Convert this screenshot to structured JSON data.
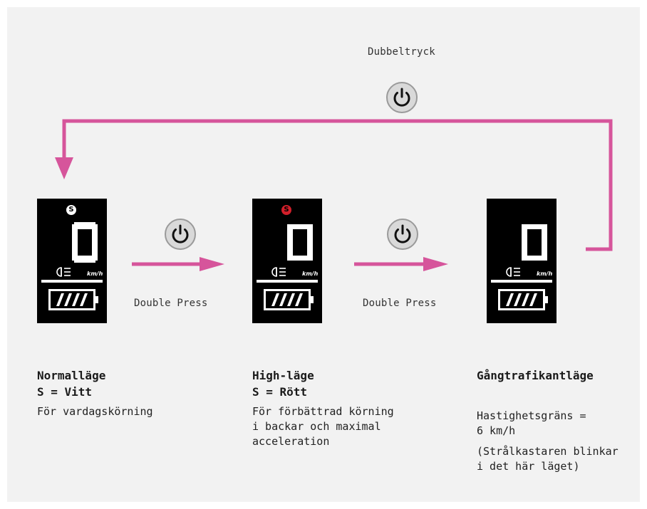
{
  "top_label": "Dubbeltryck",
  "arrow_labels": [
    "Double Press",
    "Double Press"
  ],
  "colors": {
    "arrow": "#d6559b",
    "badge_white": "#ffffff",
    "badge_red": "#d11f2a",
    "panel_bg": "#f2f2f2"
  },
  "displays": [
    {
      "speed": "0",
      "badge": "S",
      "badge_color": "white",
      "unit": "km/h"
    },
    {
      "speed": "0",
      "badge": "S",
      "badge_color": "red",
      "unit": "km/h"
    },
    {
      "speed": "0",
      "badge": "",
      "badge_color": "none",
      "unit": "km/h"
    }
  ],
  "icons": [
    "power-icon",
    "headlight-icon",
    "battery-icon"
  ],
  "modes": [
    {
      "title_line1": "Normalläge",
      "title_line2": "S = Vitt",
      "desc_lines": [
        "För vardagskörning"
      ]
    },
    {
      "title_line1": "High-läge",
      "title_line2": "S = Rött",
      "desc_lines": [
        "För förbättrad körning",
        "i backar och maximal",
        "acceleration"
      ]
    },
    {
      "title_line1": "Gångtrafikantläge",
      "desc_lines": [
        "Hastighetsgräns =",
        "6 km/h"
      ],
      "note_lines": [
        "(Strålkastaren blinkar",
        "i det här läget)"
      ]
    }
  ]
}
